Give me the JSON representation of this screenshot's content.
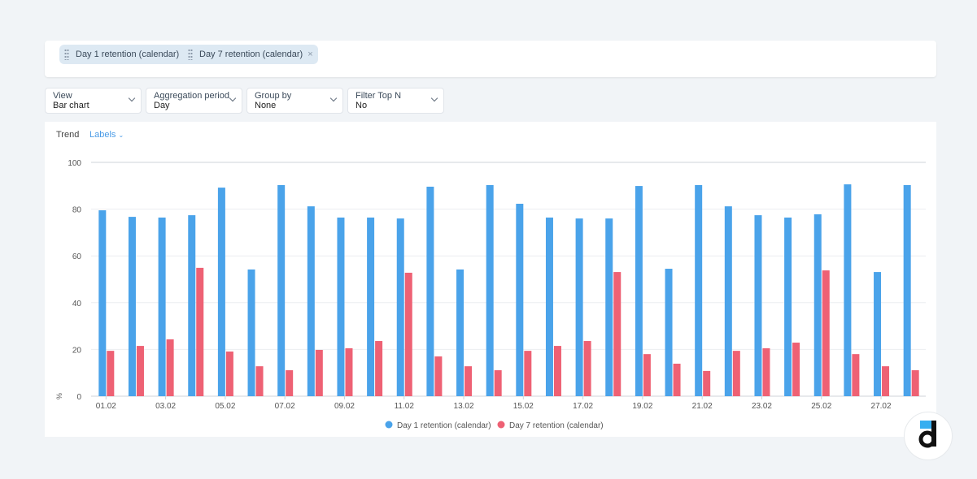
{
  "metrics": [
    {
      "label": "Day 1 retention (calendar)"
    },
    {
      "label": "Day 7 retention (calendar)"
    }
  ],
  "filters": [
    {
      "label": "View",
      "value": "Bar chart"
    },
    {
      "label": "Aggregation period",
      "value": "Day"
    },
    {
      "label": "Group by",
      "value": "None"
    },
    {
      "label": "Filter Top N",
      "value": "No"
    }
  ],
  "chart_header": {
    "trend": "Trend",
    "labels": "Labels"
  },
  "colors": {
    "series1": "#4aa3ea",
    "series2": "#ee6174"
  },
  "chart_data": {
    "type": "bar",
    "ylabel": "%",
    "ylim": [
      0,
      100
    ],
    "yticks": [
      0,
      20,
      40,
      60,
      80,
      100
    ],
    "grid": true,
    "legend": "bottom",
    "categories": [
      "01.02",
      "02.02",
      "03.02",
      "04.02",
      "05.02",
      "06.02",
      "07.02",
      "08.02",
      "09.02",
      "10.02",
      "11.02",
      "12.02",
      "13.02",
      "14.02",
      "15.02",
      "16.02",
      "17.02",
      "18.02",
      "19.02",
      "20.02",
      "21.02",
      "22.02",
      "23.02",
      "24.02",
      "25.02",
      "26.02",
      "27.02",
      "28.02"
    ],
    "xtick_labels": [
      "01.02",
      "03.02",
      "05.02",
      "07.02",
      "09.02",
      "11.02",
      "13.02",
      "15.02",
      "17.02",
      "19.02",
      "21.02",
      "23.02",
      "25.02",
      "27.02"
    ],
    "series": [
      {
        "name": "Day 1 retention (calendar)",
        "values": [
          79.5,
          76.7,
          76.4,
          77.4,
          89.2,
          54.2,
          90.3,
          81.2,
          76.4,
          76.4,
          76,
          89.6,
          54.2,
          90.3,
          82.3,
          76.4,
          76,
          76,
          89.9,
          54.5,
          90.3,
          81.2,
          77.4,
          76.4,
          77.8,
          90.6,
          53.1,
          90.3
        ]
      },
      {
        "name": "Day 7 retention (calendar)",
        "values": [
          19.4,
          21.5,
          24.3,
          54.9,
          19.1,
          12.8,
          11.1,
          19.8,
          20.5,
          23.6,
          52.8,
          17,
          12.8,
          11.1,
          19.4,
          21.5,
          23.6,
          53.1,
          18,
          13.9,
          10.8,
          19.4,
          20.5,
          22.9,
          53.8,
          18,
          12.8,
          11.1
        ]
      }
    ]
  }
}
